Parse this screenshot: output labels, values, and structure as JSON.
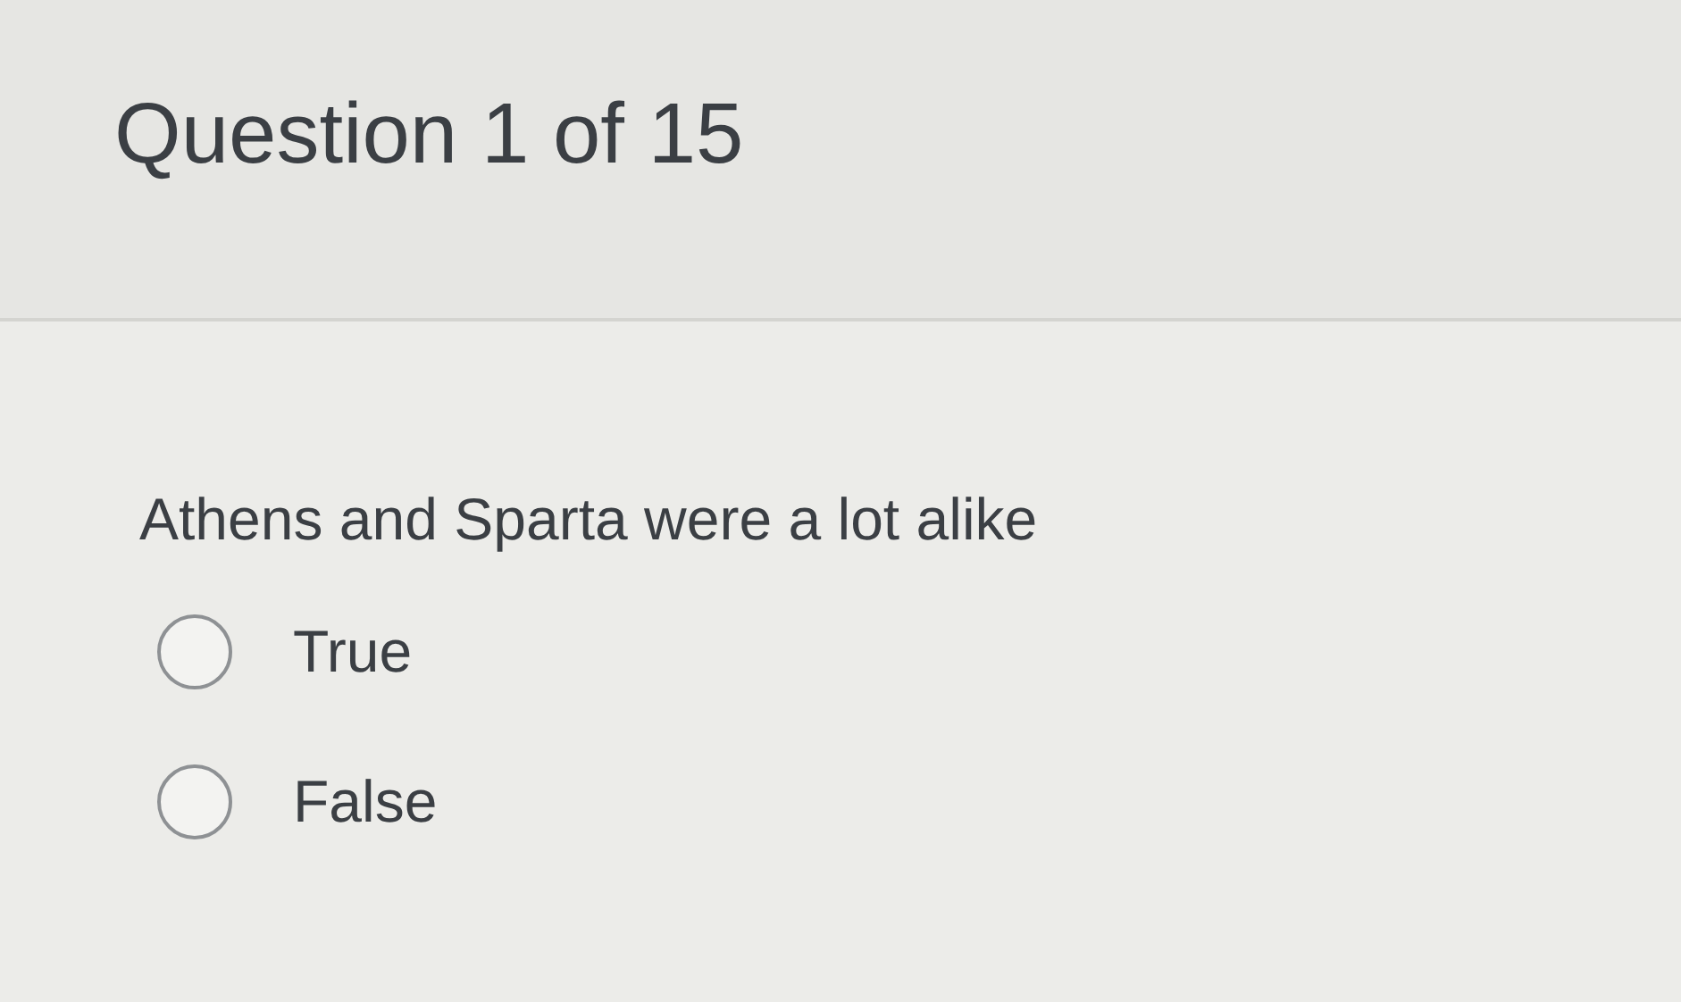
{
  "header": {
    "title": "Question 1 of 15"
  },
  "question": {
    "text": "Athens and Sparta were a lot alike",
    "options": [
      {
        "label": "True",
        "selected": false
      },
      {
        "label": "False",
        "selected": false
      }
    ]
  }
}
